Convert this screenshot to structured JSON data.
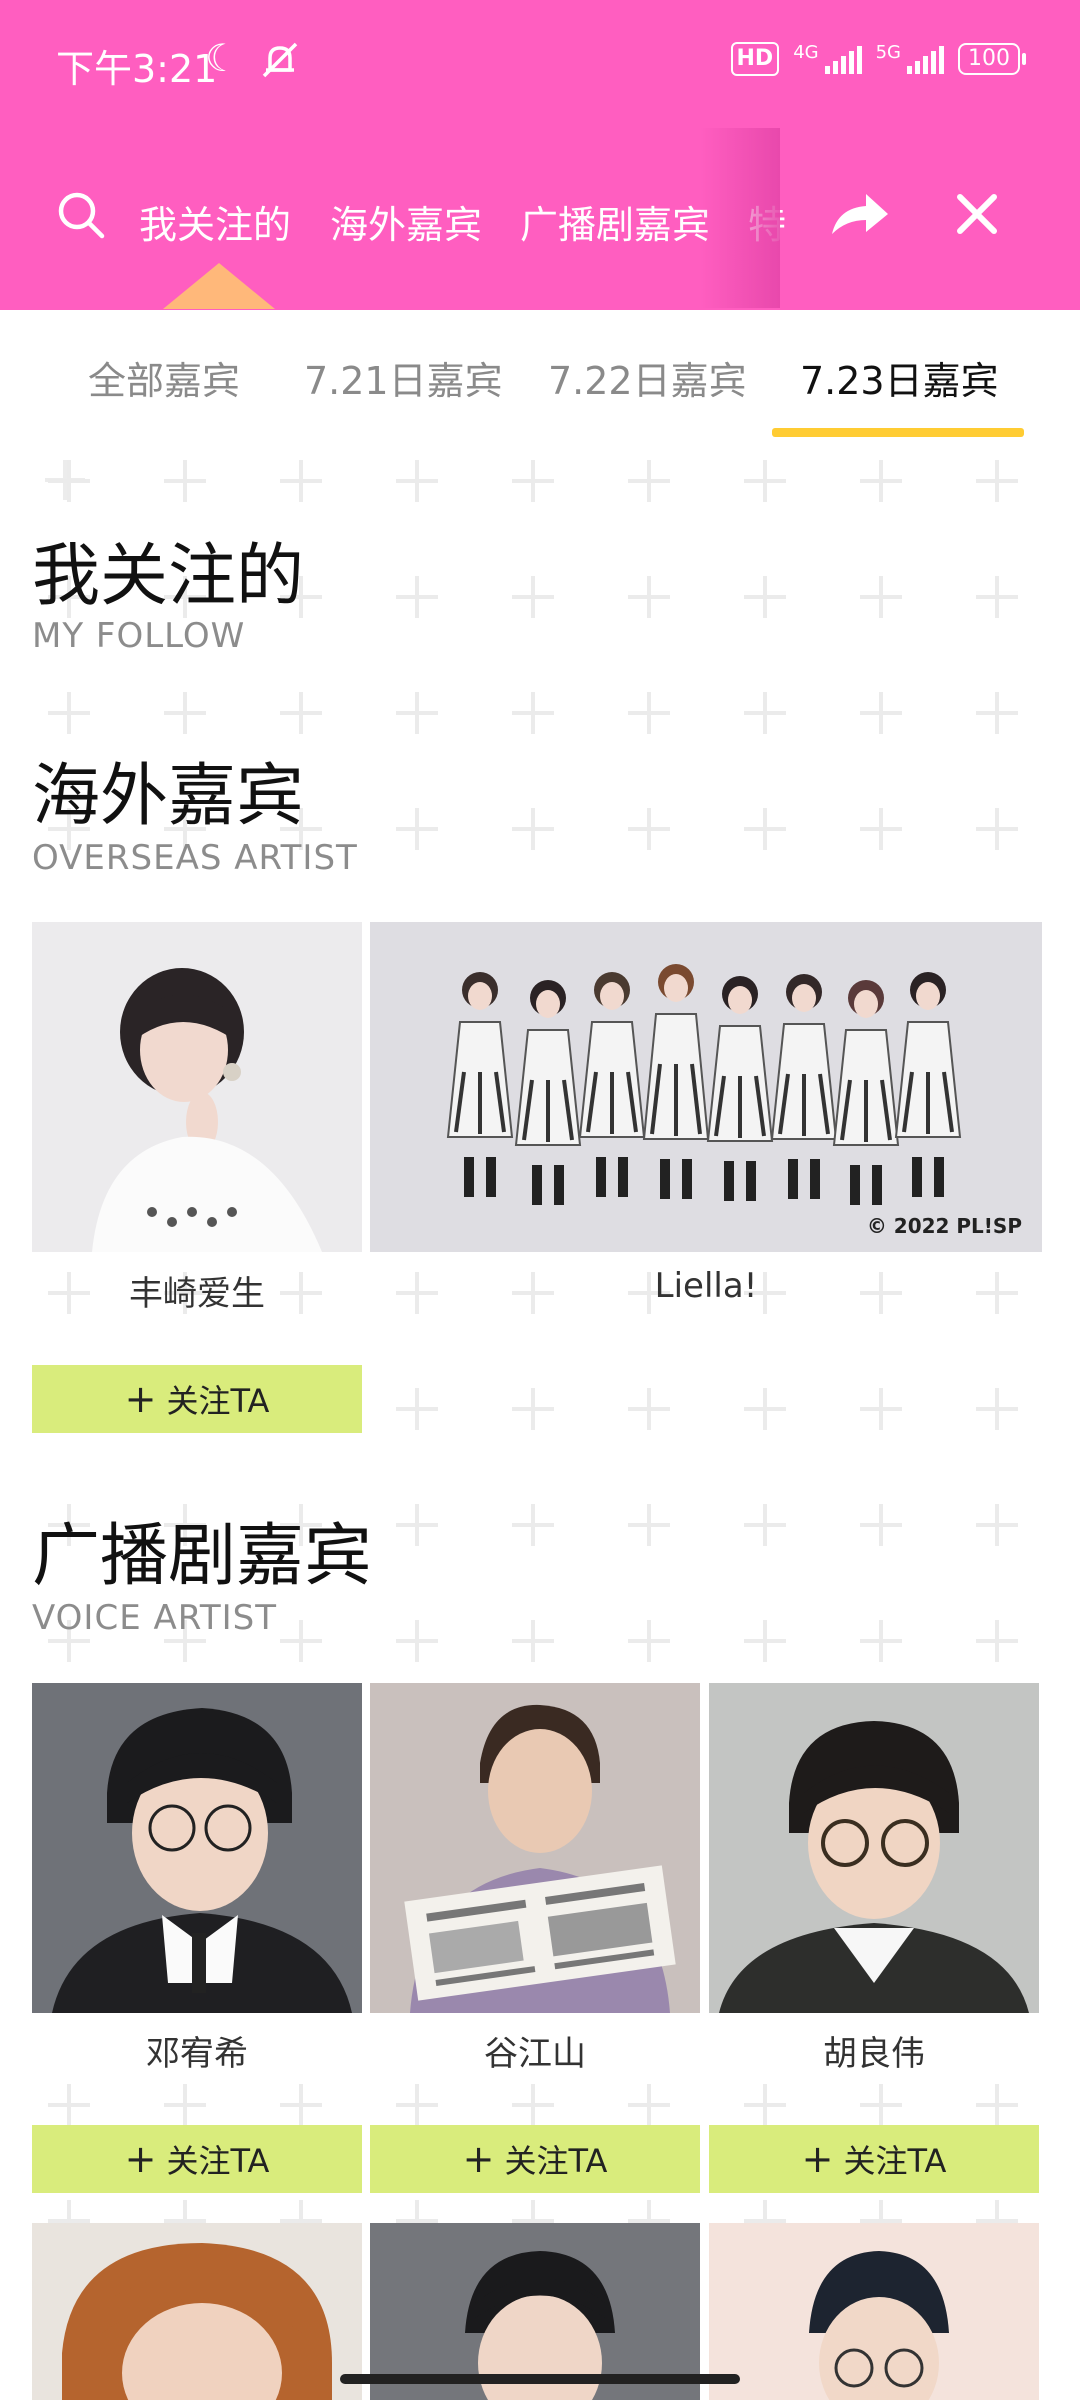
{
  "status_bar": {
    "time": "下午3:21",
    "hd": "HD",
    "net1": "4G",
    "net2": "5G",
    "battery": "100"
  },
  "nav": {
    "items": [
      "我关注的",
      "海外嘉宾",
      "广播剧嘉宾",
      "特"
    ]
  },
  "tabs": [
    "全部嘉宾",
    "7.21日嘉宾",
    "7.22日嘉宾",
    "7.23日嘉宾"
  ],
  "sections": {
    "follow": {
      "title": "我关注的",
      "subtitle": "MY FOLLOW"
    },
    "overseas": {
      "title": "海外嘉宾",
      "subtitle": "OVERSEAS ARTIST",
      "artists": [
        "丰崎爱生",
        "Liella!"
      ],
      "credit": "© 2022 PL!SP"
    },
    "voice": {
      "title": "广播剧嘉宾",
      "subtitle": "VOICE ARTIST",
      "artists": [
        "邓宥希",
        "谷江山",
        "胡良伟"
      ]
    }
  },
  "follow_label": "关注TA",
  "colors": {
    "header": "#ff5ec0",
    "tab_indicator": "#ffcc33",
    "follow_button": "#d9ec7c"
  }
}
